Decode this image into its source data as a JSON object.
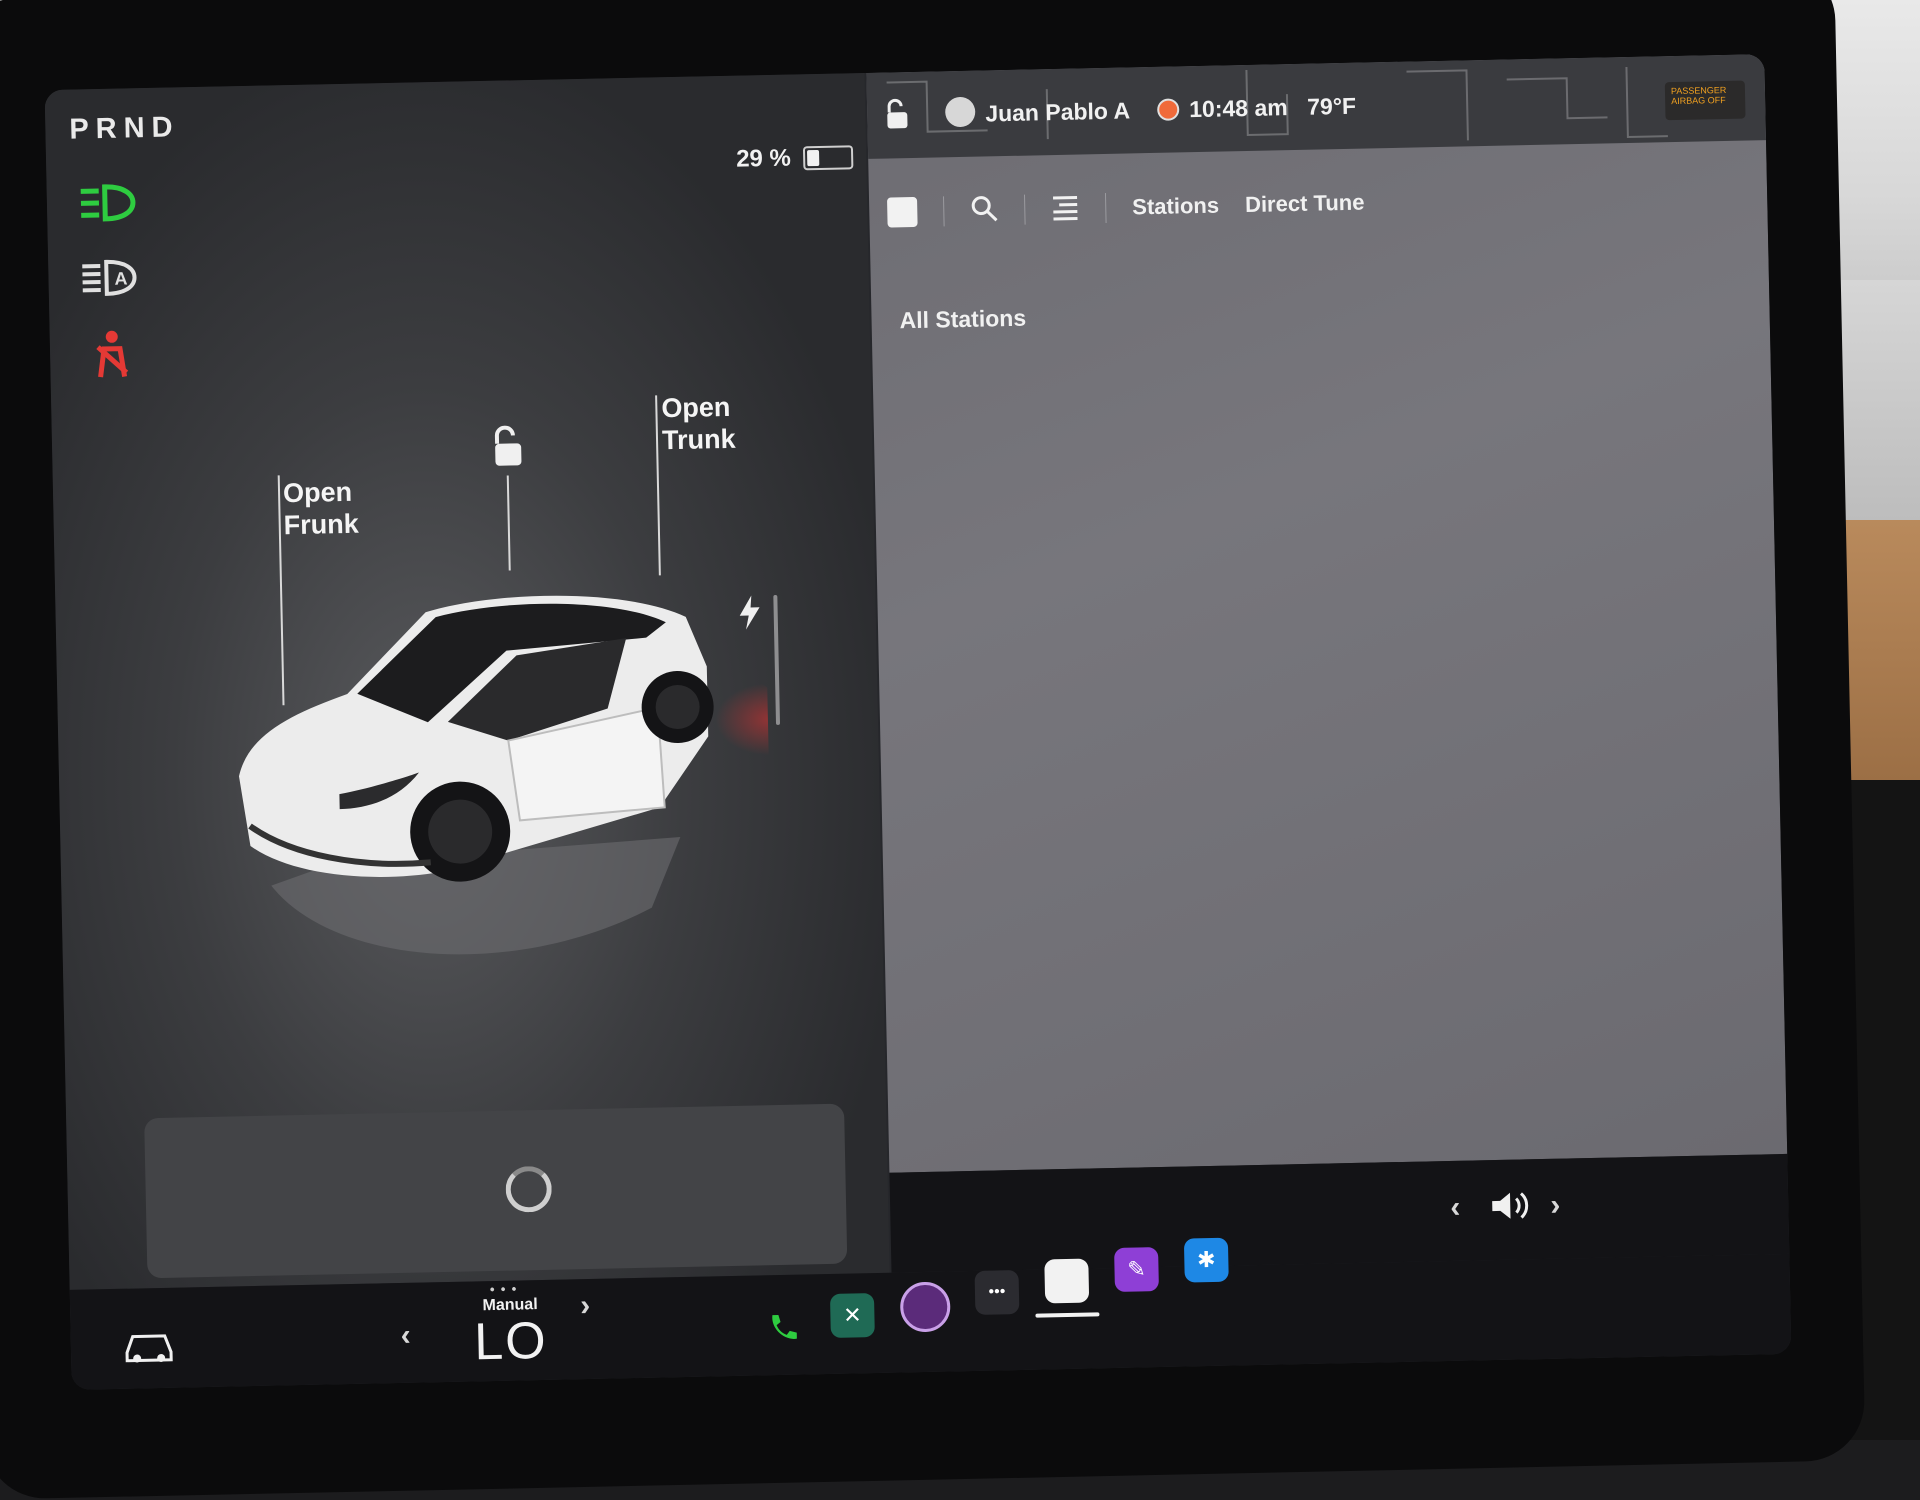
{
  "status": {
    "gear": "PRND",
    "battery_percent": "29 %",
    "battery_level": 0.29,
    "profile_name": "Juan Pablo A",
    "time": "10:48 am",
    "temperature": "79°F",
    "airbag_badge": "PASSENGER AIRBAG OFF"
  },
  "car": {
    "open_frunk": "Open\nFrunk",
    "open_trunk": "Open\nTrunk"
  },
  "media": {
    "tabs": [
      "Stations",
      "Direct Tune"
    ],
    "section_title": "All Stations"
  },
  "climate": {
    "mode": "Manual",
    "temp": "LO"
  },
  "colors": {
    "headlight_green": "#2ecc40",
    "seatbelt_red": "#e53935",
    "phone_green": "#2ecc40",
    "bluetooth_blue": "#1e88e5"
  }
}
